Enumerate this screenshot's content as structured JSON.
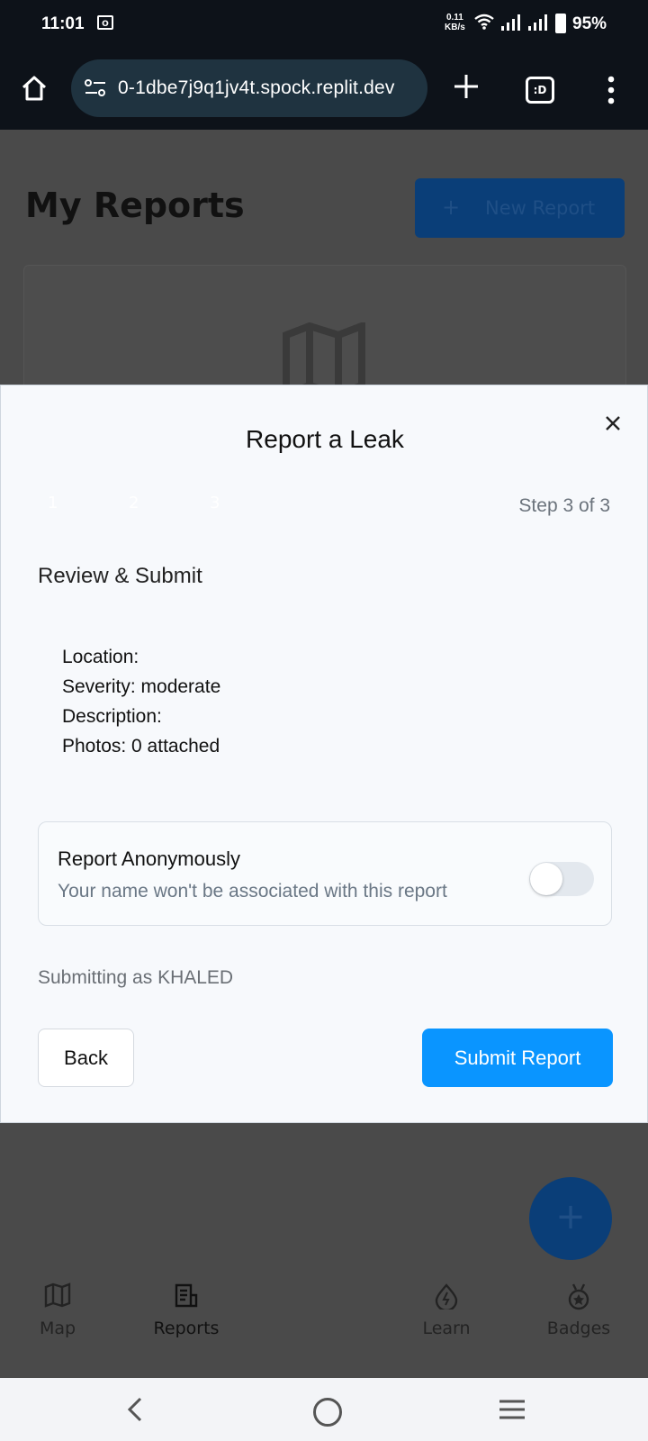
{
  "status_bar": {
    "time": "11:01",
    "notification_icon": "outlook-icon",
    "net_speed_value": "0.11",
    "net_speed_unit": "KB/s",
    "battery": "95%"
  },
  "browser": {
    "url": "0-1dbe7j9q1jv4t.spock.replit.dev",
    "tab_label": ":D"
  },
  "page": {
    "title": "My Reports",
    "new_report_label": "New Report"
  },
  "modal": {
    "title": "Report a Leak",
    "steps": [
      "1",
      "2",
      "3"
    ],
    "step_indicator": "Step 3 of 3",
    "section_title": "Review & Submit",
    "summary": {
      "location": "Location:",
      "severity": "Severity: moderate",
      "description": "Description:",
      "photos": "Photos: 0 attached"
    },
    "anonymous": {
      "heading": "Report Anonymously",
      "subtext": "Your name won't be associated with this report",
      "enabled": false
    },
    "submitting_as": "Submitting as KHALED",
    "back_label": "Back",
    "submit_label": "Submit Report"
  },
  "bottom_nav": [
    {
      "label": "Map",
      "icon": "map-icon"
    },
    {
      "label": "Reports",
      "icon": "reports-icon",
      "active": true
    },
    {
      "label": "Learn",
      "icon": "droplet-icon"
    },
    {
      "label": "Badges",
      "icon": "badge-icon"
    }
  ],
  "colors": {
    "primary": "#0a95ff",
    "overlay": "#4a4a4a",
    "modal_bg": "#f7f9fc"
  }
}
